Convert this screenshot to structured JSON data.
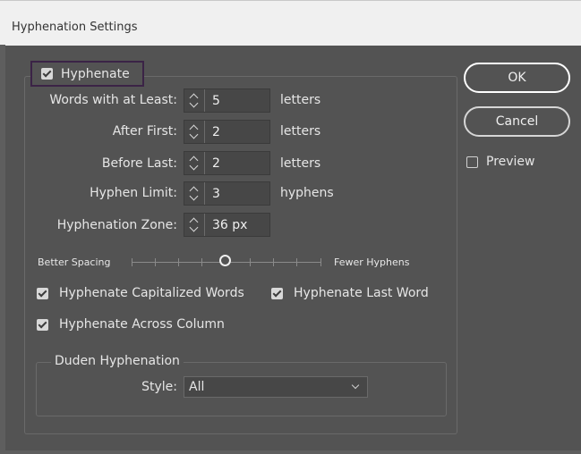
{
  "window": {
    "title": "Hyphenation Settings"
  },
  "hyphenate": {
    "label": "Hyphenate",
    "checked": true
  },
  "fields": [
    {
      "label": "Words with at Least:",
      "value": "5",
      "unit": "letters"
    },
    {
      "label": "After First:",
      "value": "2",
      "unit": "letters"
    },
    {
      "label": "Before Last:",
      "value": "2",
      "unit": "letters"
    },
    {
      "label": "Hyphen Limit:",
      "value": "3",
      "unit": "hyphens"
    },
    {
      "label": "Hyphenation Zone:",
      "value": "36 px",
      "unit": ""
    }
  ],
  "slider": {
    "left_label": "Better Spacing",
    "right_label": "Fewer Hyphens",
    "position": 0.5
  },
  "options": {
    "capitalized": {
      "label": "Hyphenate Capitalized Words",
      "checked": true
    },
    "last_word": {
      "label": "Hyphenate Last Word",
      "checked": true
    },
    "across_column": {
      "label": "Hyphenate Across Column",
      "checked": true
    }
  },
  "duden": {
    "title": "Duden Hyphenation",
    "style_label": "Style:",
    "style_value": "All"
  },
  "buttons": {
    "ok": "OK",
    "cancel": "Cancel"
  },
  "preview": {
    "label": "Preview",
    "checked": false
  }
}
